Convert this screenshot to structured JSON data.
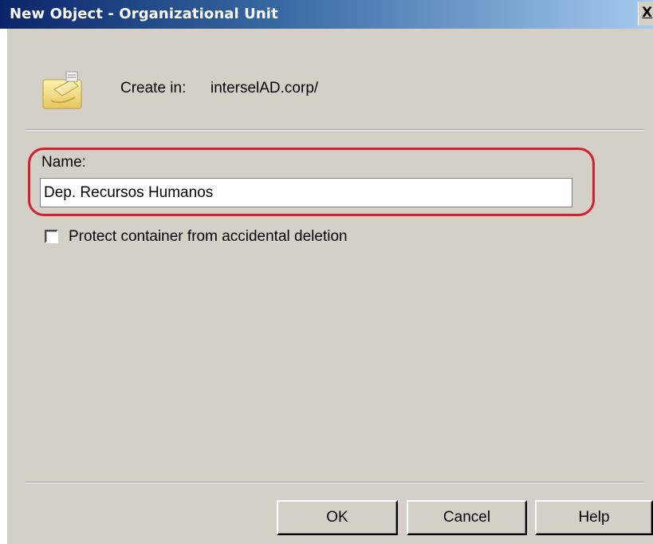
{
  "window": {
    "title": "New Object - Organizational Unit",
    "close_glyph": "X"
  },
  "header": {
    "icon": "organizational-unit-folder-icon",
    "create_in_label": "Create in:",
    "create_in_value": "interselAD.corp/"
  },
  "form": {
    "name_label": "Name:",
    "name_value": "Dep. Recursos Humanos",
    "protect_label": "Protect container from accidental deletion",
    "protect_checked": false
  },
  "buttons": {
    "ok": "OK",
    "cancel": "Cancel",
    "help": "Help"
  },
  "colors": {
    "title_bar_start": "#0a246a",
    "title_bar_end": "#a6caf0",
    "dialog_background": "#d4d0c8",
    "highlight_outline": "#d2202f"
  }
}
